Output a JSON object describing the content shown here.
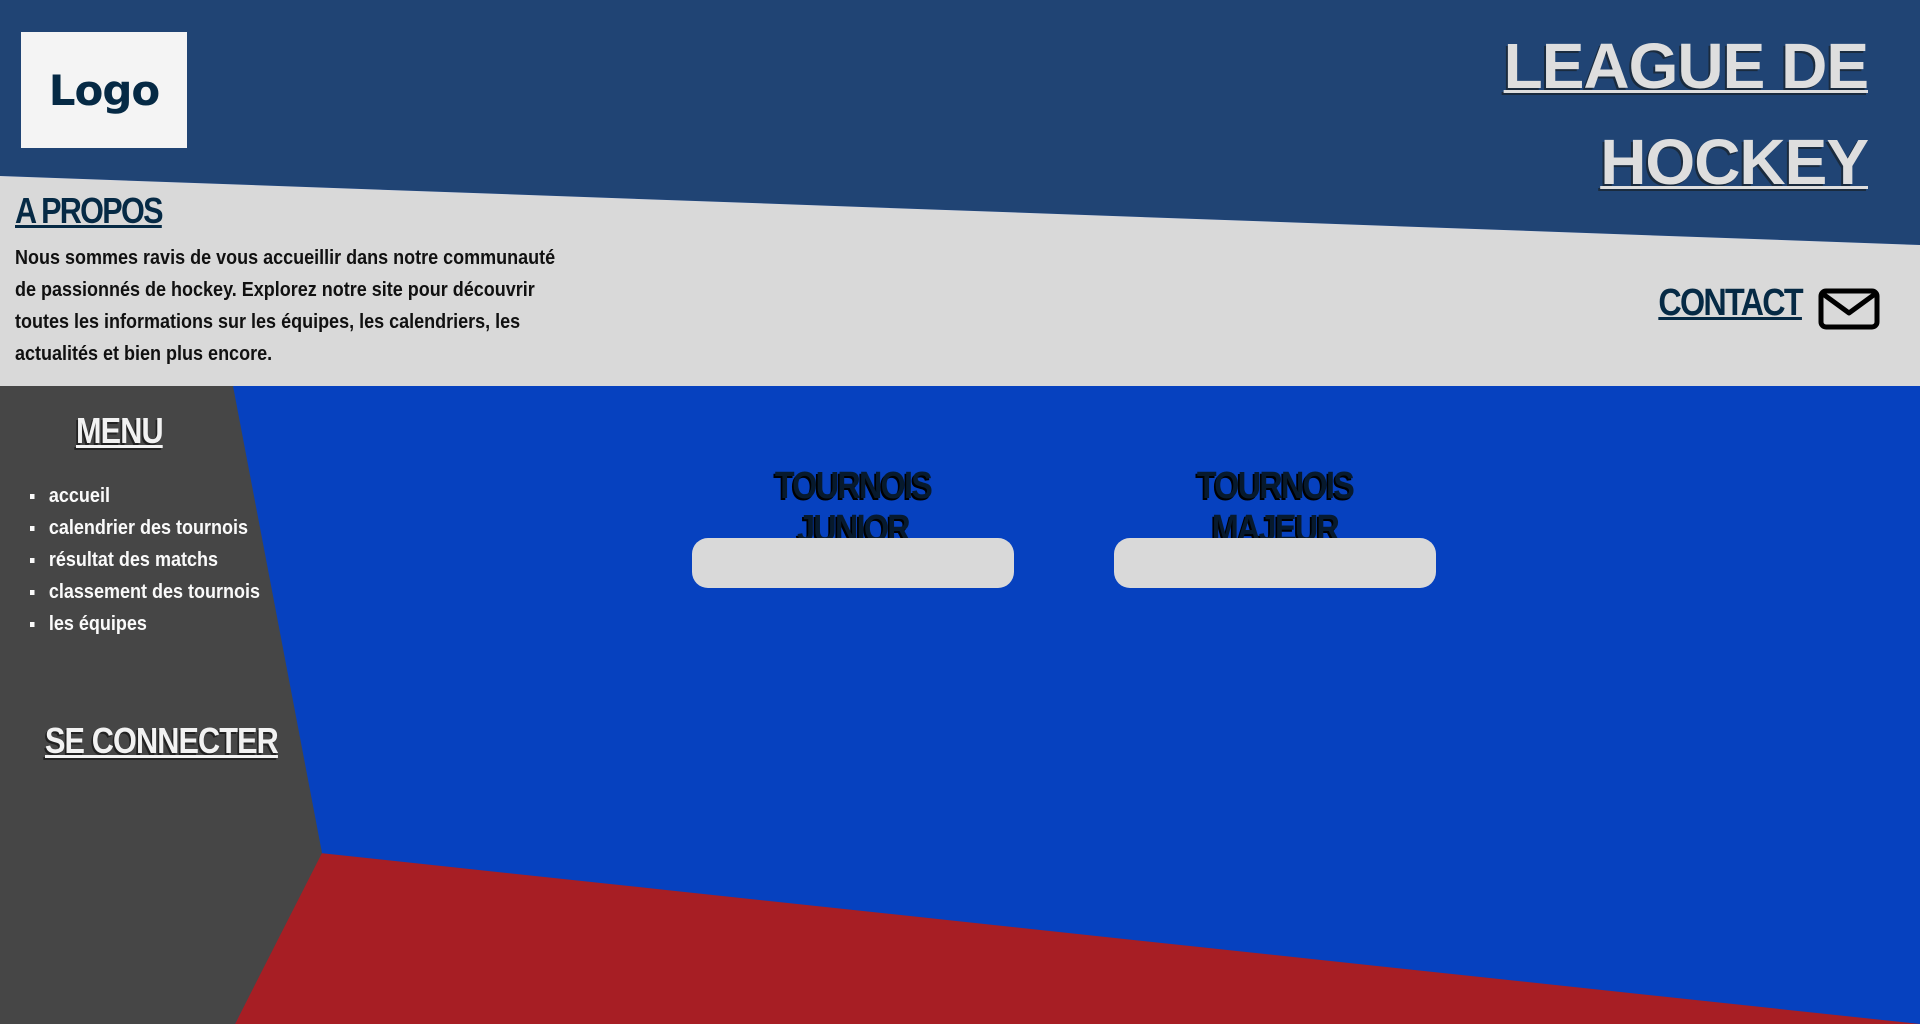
{
  "colors": {
    "header_bg": "#204474",
    "about_band": "#d9d9d9",
    "sidebar": "#464646",
    "main_bg": "#0641bf",
    "footer_red": "#a71e24",
    "accent_dark": "#062a45"
  },
  "header": {
    "logo_label": "Logo",
    "title_line1": "LEAGUE DE",
    "title_line2": "HOCKEY"
  },
  "about": {
    "title": "A PROPOS",
    "text": "Nous sommes ravis de vous accueillir dans notre communauté de passionnés de hockey.  Explorez notre site pour découvrir toutes les informations sur les équipes, les calendriers, les actualités et bien plus encore."
  },
  "contact": {
    "label": "CONTACT",
    "icon": "mail-icon"
  },
  "sidebar": {
    "menu_title": "MENU",
    "items": [
      {
        "label": "accueil"
      },
      {
        "label": "calendrier des tournois"
      },
      {
        "label": "résultat des matchs"
      },
      {
        "label": "classement des tournois"
      },
      {
        "label": "les équipes"
      }
    ],
    "login_label": "SE CONNECTER"
  },
  "main": {
    "tournaments": [
      {
        "title": "TOURNOIS JUNIOR"
      },
      {
        "title": "TOURNOIS MAJEUR"
      }
    ]
  }
}
